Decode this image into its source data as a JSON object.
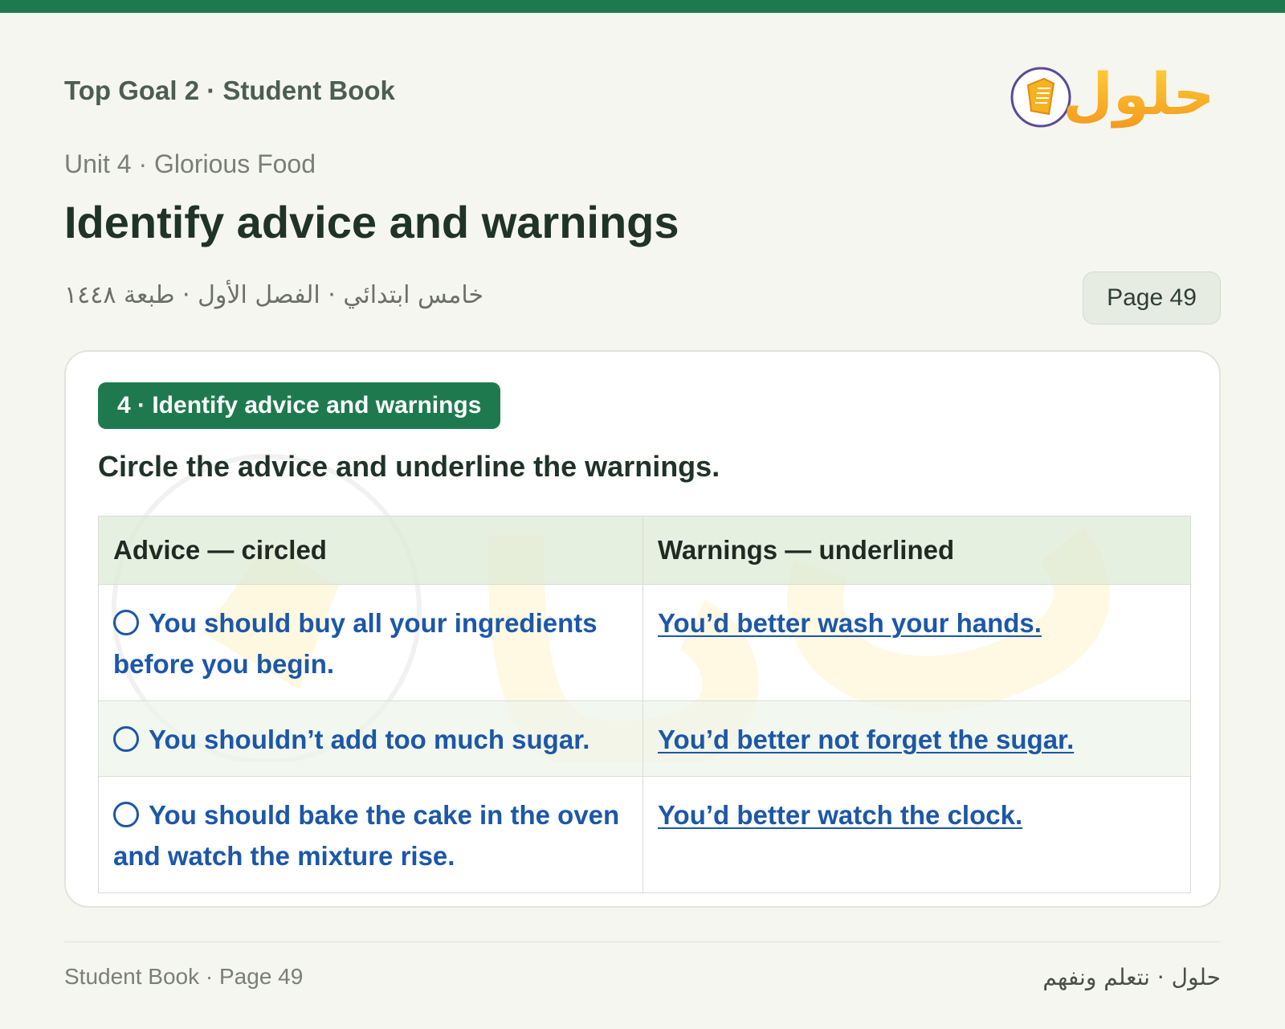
{
  "header": {
    "book_title": "Top Goal 2 · Student Book",
    "logo_text": "حلول",
    "unit": "Unit 4 · Glorious Food",
    "page_title": "Identify advice and warnings",
    "arabic_subtitle": "خامس ابتدائي · الفصل الأول · طبعة ١٤٤٨",
    "page_label": "Page 49"
  },
  "exercise": {
    "badge": "4 · Identify advice and warnings",
    "instruction": "Circle the advice and underline the warnings.",
    "columns": [
      "Advice — circled",
      "Warnings — underlined"
    ],
    "rows": [
      {
        "advice": "You should buy all your ingredients before you begin.",
        "warning": "You’d better wash your hands."
      },
      {
        "advice": "You shouldn’t add too much sugar.",
        "warning": "You’d better not forget the sugar."
      },
      {
        "advice": "You should bake the cake in the oven and watch the mixture rise.",
        "warning": "You’d better watch the clock."
      }
    ]
  },
  "footer": {
    "left": "Student Book · Page 49",
    "right": "حلول · نتعلم ونفهم"
  },
  "colors": {
    "brand_green": "#1e7a4e",
    "answer_blue": "#1c57a8",
    "logo_orange": "#f5a623"
  },
  "icons": [
    "book-icon",
    "answer-circle-icon"
  ]
}
